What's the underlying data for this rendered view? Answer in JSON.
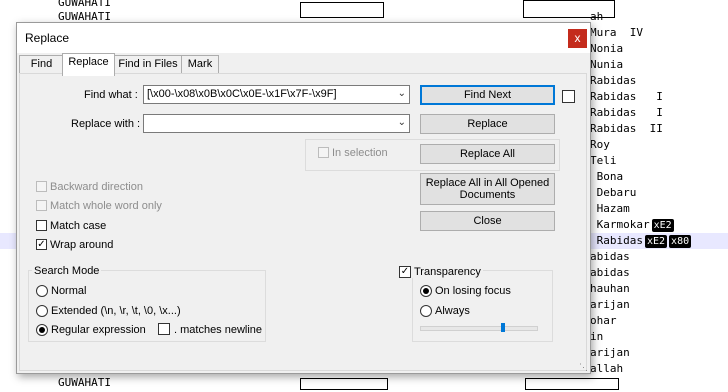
{
  "background_editor": {
    "left_lines": [
      "GUWAHATI",
      "GUWAHATI"
    ],
    "right_lines": [
      "ah",
      "Mura  IV",
      "Nonia",
      "Nunia",
      "Rabidas",
      "Rabidas   I",
      "Rabidas   I",
      "Rabidas  II",
      "Roy",
      "Teli",
      " Bona",
      " Debaru",
      " Hazam",
      " Karmokar",
      " Rabidas",
      "abidas",
      "abidas",
      "hauhan",
      "arijan",
      "ohar",
      "in",
      "arijan",
      "allah"
    ],
    "ctrl_badges": {
      "karmokar": [
        "xE2"
      ],
      "rabidas": [
        "xE2",
        "x80"
      ]
    }
  },
  "dialog": {
    "title": "Replace",
    "close_symbol": "x",
    "tabs": [
      {
        "label": "Find",
        "active": false
      },
      {
        "label": "Replace",
        "active": true
      },
      {
        "label": "Find in Files",
        "active": false
      },
      {
        "label": "Mark",
        "active": false
      }
    ],
    "find_what_label": "Find what :",
    "find_what_value": "[\\x00-\\x08\\x0B\\x0C\\x0E-\\x1F\\x7F-\\x9F]",
    "replace_with_label": "Replace with :",
    "replace_with_value": "",
    "in_selection_label": "In selection",
    "buttons": {
      "find_next": "Find Next",
      "replace": "Replace",
      "replace_all": "Replace All",
      "replace_all_opened": "Replace All in All Opened Documents",
      "close": "Close"
    },
    "options": {
      "backward_direction": "Backward direction",
      "match_whole_word": "Match whole word only",
      "match_case": "Match case",
      "wrap_around": "Wrap around"
    },
    "search_mode": {
      "title": "Search Mode",
      "normal": "Normal",
      "extended": "Extended (\\n, \\r, \\t, \\0, \\x...)",
      "regex": "Regular expression",
      "matches_newline": ". matches newline",
      "selected": "regex"
    },
    "transparency": {
      "title": "Transparency",
      "checked": true,
      "on_losing_focus": "On losing focus",
      "always": "Always",
      "selected": "on_losing_focus",
      "level": 0.7
    }
  }
}
